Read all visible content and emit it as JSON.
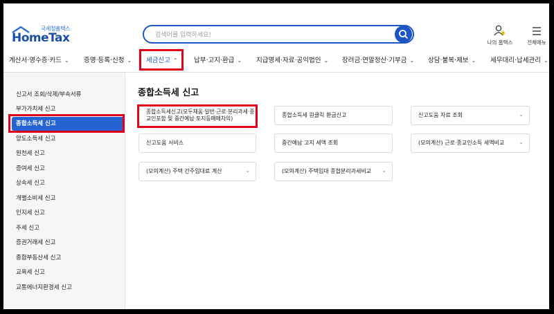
{
  "header": {
    "logo_small": "국세청홈택스",
    "logo_main": "HomeTax",
    "search_placeholder": "검색어를 입력하세요!",
    "my_hometax": "나의 홈택스",
    "all_menu": "전체메뉴"
  },
  "nav": {
    "items": [
      {
        "label": "계산서·영수증·카드"
      },
      {
        "label": "증명·등록·신청"
      },
      {
        "label": "세금신고"
      },
      {
        "label": "납부·고지·환급"
      },
      {
        "label": "지급명세·자료·공익법인"
      },
      {
        "label": "장려금·연말정산·기부금"
      },
      {
        "label": "상담·불복·제보"
      },
      {
        "label": "세무대리·납세관리"
      }
    ]
  },
  "sidebar": {
    "items": [
      {
        "label": "신고서 조회/삭제/부속서류"
      },
      {
        "label": "부가가치세 신고"
      },
      {
        "label": "종합소득세 신고"
      },
      {
        "label": "양도소득세 신고"
      },
      {
        "label": "원천세 신고"
      },
      {
        "label": "증여세 신고"
      },
      {
        "label": "상속세 신고"
      },
      {
        "label": "개별소비세 신고"
      },
      {
        "label": "인지세 신고"
      },
      {
        "label": "주세 신고"
      },
      {
        "label": "증권거래세 신고"
      },
      {
        "label": "종합부동산세 신고"
      },
      {
        "label": "교육세 신고"
      },
      {
        "label": "교통에너지환경세 신고"
      }
    ]
  },
  "main": {
    "title": "종합소득세 신고",
    "cards": [
      {
        "label": "종합소득세신고(모두채움·일반·근로·분리과세·종교인포함 및 중간예납·토지등매매차익)"
      },
      {
        "label": "종합소득세 원클릭 환급신고"
      },
      {
        "label": "신고도움 자료 조회"
      },
      {
        "label": "신고도움 서비스"
      },
      {
        "label": "중간예납 고지 세액 조회"
      },
      {
        "label": "(모의계산) 근로·종교인소득 세액비교"
      },
      {
        "label": "(모의계산) 주택 간주임대료 계산"
      },
      {
        "label": "(모의계산) 주택임대 종합분리과세비교"
      }
    ]
  },
  "colors": {
    "accent": "#1e55c4",
    "highlight": "#e0001a",
    "active_side": "#2563d3"
  }
}
